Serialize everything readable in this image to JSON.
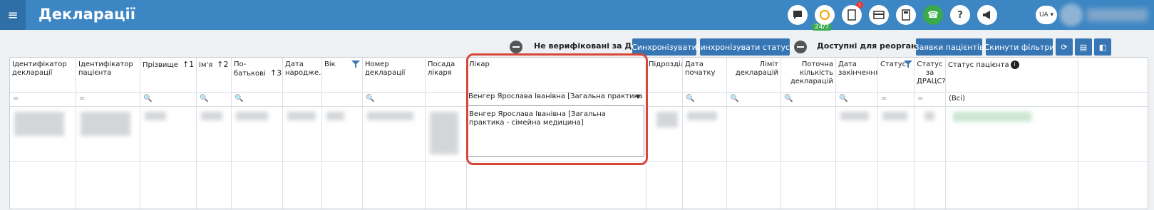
{
  "header": {
    "menu_icon": "hamburger-icon",
    "title": "Декларації",
    "badge_247": "24/7",
    "notification_count": "!",
    "language": "UA ▾"
  },
  "toolbar": {
    "toggle1_label": "Не верифіковані за ДРАЦС",
    "sync_button": "Синхронізувати",
    "sync_status_button": "Синхронізувати статуси",
    "toggle2_label": "Доступні для реорганізації",
    "patient_requests_button": "Заявки пацієнтів",
    "reset_filters_button": "Скинути фільтри"
  },
  "columns": [
    {
      "key": "decl_id",
      "label": "Ідентифікатор декларації",
      "filter": "="
    },
    {
      "key": "patient_id",
      "label": "Ідентифікатор пацієнта",
      "filter": "="
    },
    {
      "key": "surname",
      "label": "Прізвище",
      "sort": "↑1",
      "filter": "🔍"
    },
    {
      "key": "name",
      "label": "Ім'я",
      "sort": "↑2",
      "filter": "🔍"
    },
    {
      "key": "patronymic",
      "label": "По-батькові",
      "sort": "↑3",
      "filter": "🔍"
    },
    {
      "key": "birth",
      "label": "Дата народже...",
      "filter": ""
    },
    {
      "key": "age",
      "label": "Вік",
      "filter": ""
    },
    {
      "key": "decl_num",
      "label": "Номер декларації",
      "filter": "🔍"
    },
    {
      "key": "position",
      "label": "Посада лікаря",
      "filter": ""
    },
    {
      "key": "doctor",
      "label": "Лікар",
      "filter": ""
    },
    {
      "key": "division",
      "label": "Підрозділ",
      "filter": ""
    },
    {
      "key": "start",
      "label": "Дата початку",
      "filter": "🔍"
    },
    {
      "key": "limit",
      "label": "Ліміт декларацій",
      "filter": "🔍"
    },
    {
      "key": "current",
      "label": "Поточна кількість декларацій",
      "filter": "🔍"
    },
    {
      "key": "end",
      "label": "Дата закінчення",
      "filter": "🔍"
    },
    {
      "key": "status",
      "label": "Статус",
      "filter": "="
    },
    {
      "key": "drac",
      "label": "Статус за ДРАЦС?",
      "filter": "="
    },
    {
      "key": "pstatus",
      "label": "Статус пацієнта",
      "filter": "(Всі)"
    }
  ],
  "doctor_filter": {
    "selected": "Венгер Ярослава Іванівна [Загальна практика -...",
    "option": "Венгер Ярослава Іванівна [Загальна практика - сімейна медицина]"
  }
}
